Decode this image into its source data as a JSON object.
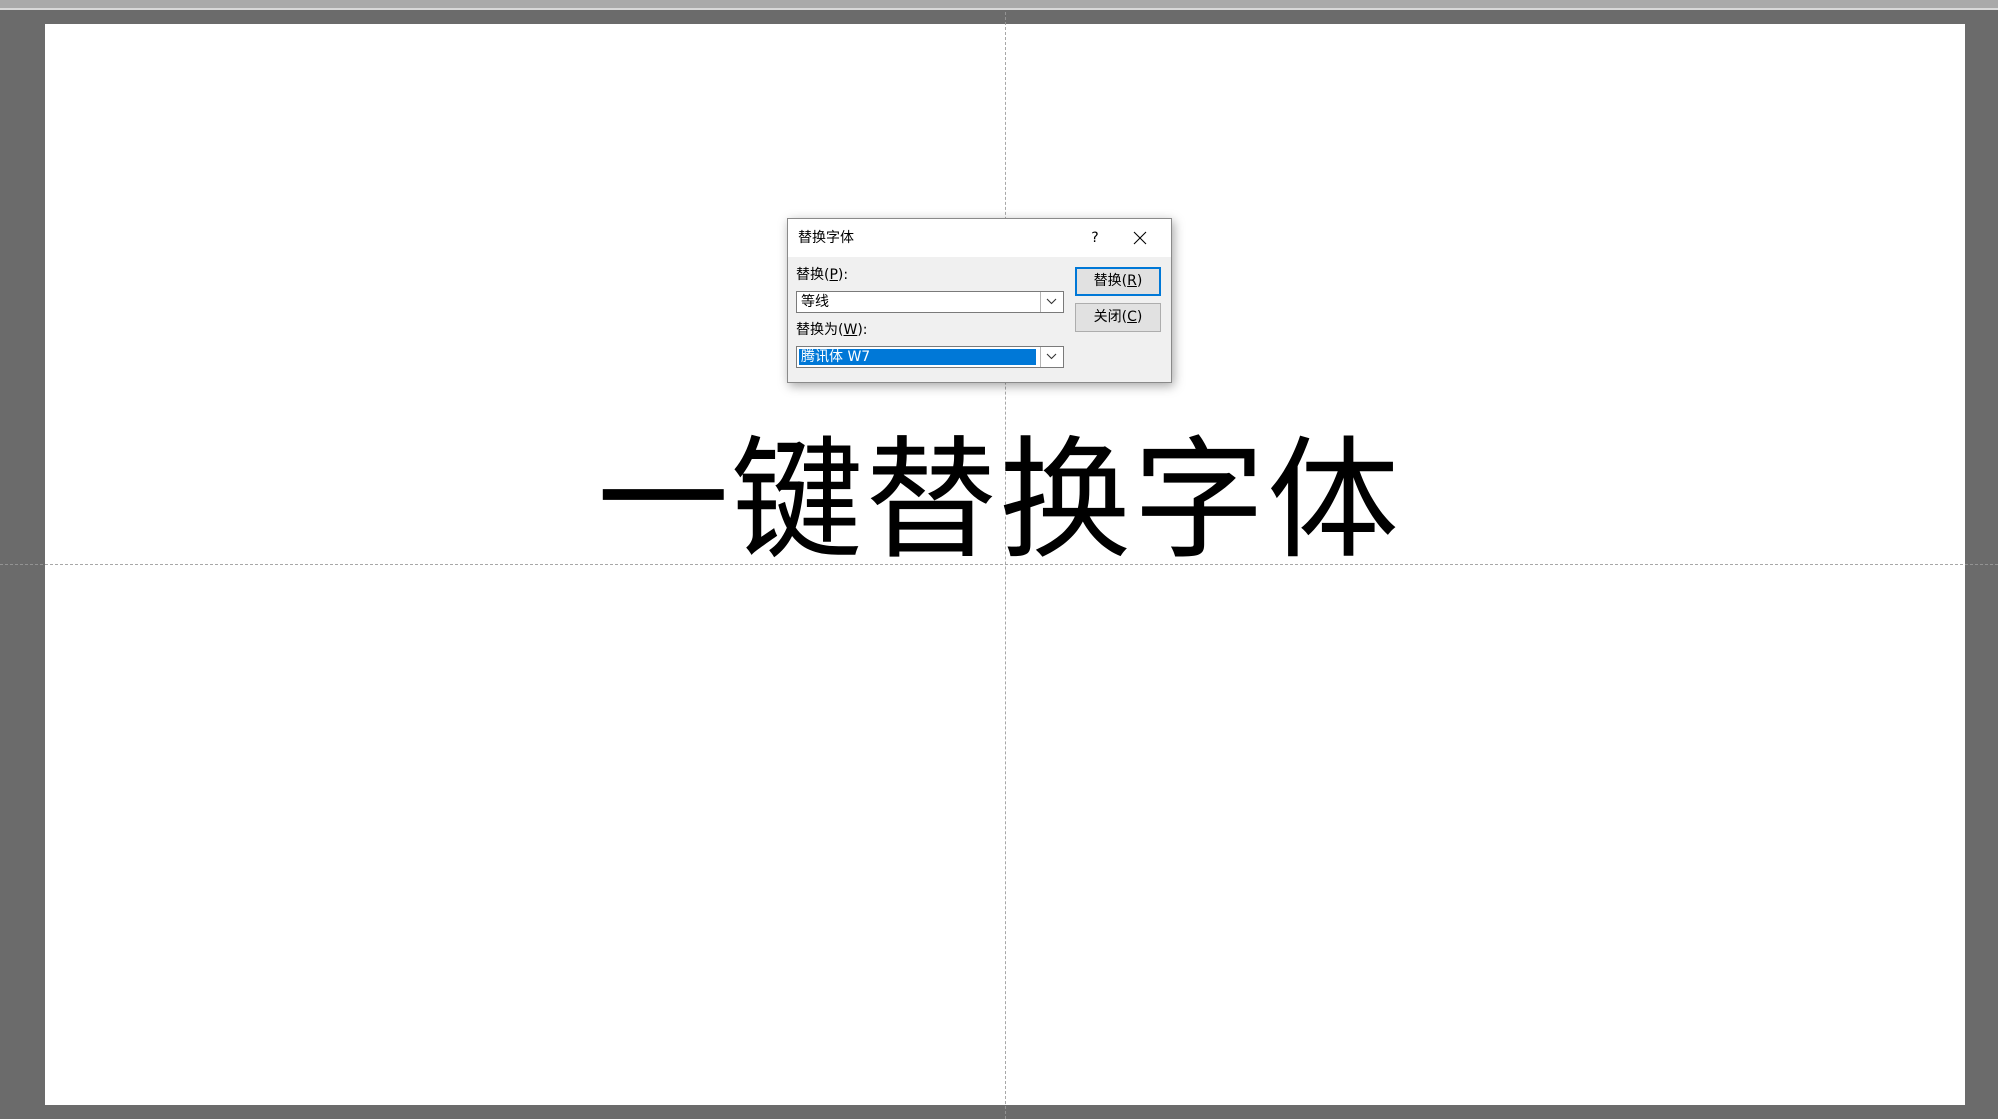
{
  "slide": {
    "title_text": "一键替换字体"
  },
  "dialog": {
    "title": "替换字体",
    "help_label": "?",
    "replace_label_text": "替换(",
    "replace_label_key": "P",
    "replace_label_suffix": "):",
    "replace_value": "等线",
    "with_label_text": "替换为(",
    "with_label_key": "W",
    "with_label_suffix": "):",
    "with_value": "腾讯体 W7",
    "replace_button_text": "替换(",
    "replace_button_key": "R",
    "replace_button_suffix": ")",
    "close_button_text": "关闭(",
    "close_button_key": "C",
    "close_button_suffix": ")"
  },
  "icons": {
    "close": "close-icon",
    "dropdown": "chevron-down-icon"
  },
  "colors": {
    "selection": "#0078d7",
    "workspace": "#6b6b6b",
    "slide": "#ffffff"
  }
}
